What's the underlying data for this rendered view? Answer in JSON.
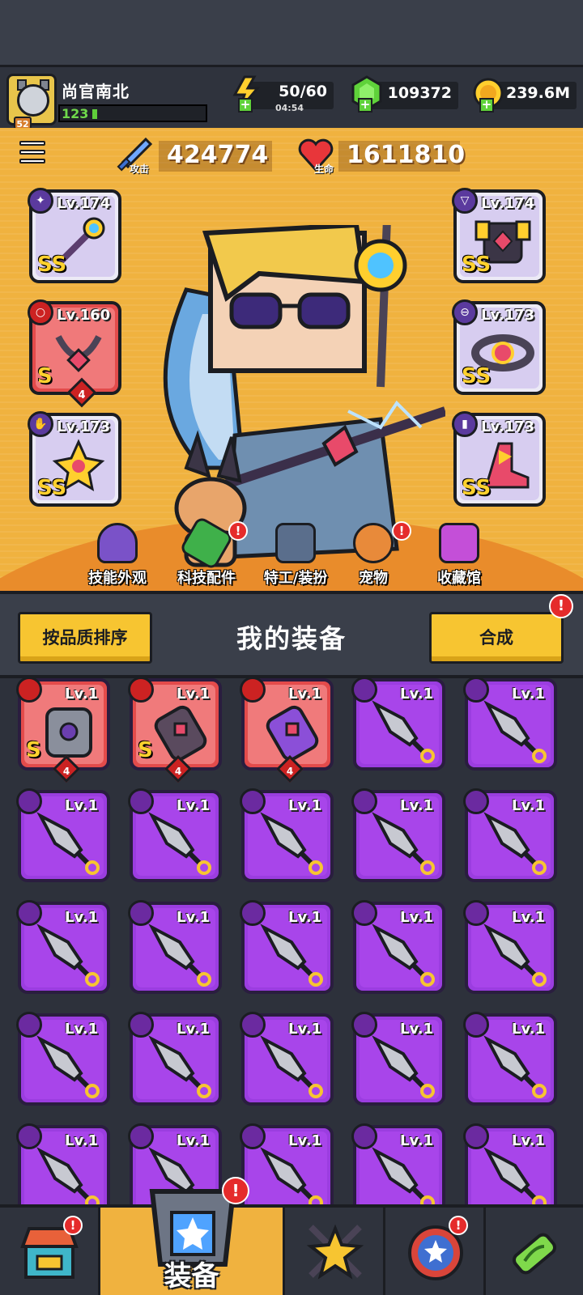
{
  "player": {
    "name": "尚官南北",
    "level_badge": "52",
    "xp_level": "123"
  },
  "resources": {
    "energy": {
      "value": "50/60",
      "timer": "04:54",
      "icon": "lightning-icon"
    },
    "gems": {
      "value": "109372",
      "icon": "green-gem-icon"
    },
    "coins": {
      "value": "239.6M",
      "icon": "gold-coin-icon"
    }
  },
  "stats": {
    "attack": {
      "value": "424774",
      "label": "攻击"
    },
    "health": {
      "value": "1611810",
      "label": "生命"
    }
  },
  "equipped": [
    {
      "slot": "weapon",
      "level": "Lv.174",
      "rank": "SS",
      "icon": "staff-weapon-icon"
    },
    {
      "slot": "necklace",
      "level": "Lv.160",
      "rank": "S",
      "stars": "4",
      "icon": "chain-necklace-icon"
    },
    {
      "slot": "gloves",
      "level": "Lv.173",
      "rank": "SS",
      "icon": "gauntlet-icon"
    },
    {
      "slot": "armor",
      "level": "Lv.174",
      "rank": "SS",
      "icon": "chest-armor-icon"
    },
    {
      "slot": "belt",
      "level": "Lv.173",
      "rank": "SS",
      "icon": "belt-icon"
    },
    {
      "slot": "boots",
      "level": "Lv.173",
      "rank": "SS",
      "icon": "boots-icon"
    }
  ],
  "features": [
    {
      "label": "技能外观",
      "icon": "skill-skin-icon",
      "alert": false
    },
    {
      "label": "科技配件",
      "icon": "tech-part-icon",
      "alert": true
    },
    {
      "label": "特工/装扮",
      "icon": "agent-costume-icon",
      "alert": false
    },
    {
      "label": "宠物",
      "icon": "pet-dog-icon",
      "alert": true
    },
    {
      "label": "收藏馆",
      "icon": "collection-chest-icon",
      "alert": false
    }
  ],
  "equipment_panel": {
    "sort_button": "按品质排序",
    "title": "我的装备",
    "merge_button": "合成"
  },
  "inventory": [
    {
      "level": "Lv.1",
      "rarity": "red",
      "rank": "S",
      "stars": "4",
      "icon": "armor-icon"
    },
    {
      "level": "Lv.1",
      "rarity": "red",
      "rank": "S",
      "stars": "4",
      "icon": "glove-icon"
    },
    {
      "level": "Lv.1",
      "rarity": "red",
      "rank": "",
      "stars": "4",
      "icon": "glove-icon"
    },
    {
      "level": "Lv.1",
      "rarity": "purple",
      "icon": "kunai-icon"
    },
    {
      "level": "Lv.1",
      "rarity": "purple",
      "icon": "kunai-icon"
    },
    {
      "level": "Lv.1",
      "rarity": "purple",
      "icon": "kunai-icon"
    },
    {
      "level": "Lv.1",
      "rarity": "purple",
      "icon": "kunai-icon"
    },
    {
      "level": "Lv.1",
      "rarity": "purple",
      "icon": "kunai-icon"
    },
    {
      "level": "Lv.1",
      "rarity": "purple",
      "icon": "kunai-icon"
    },
    {
      "level": "Lv.1",
      "rarity": "purple",
      "icon": "kunai-icon"
    },
    {
      "level": "Lv.1",
      "rarity": "purple",
      "icon": "kunai-icon"
    },
    {
      "level": "Lv.1",
      "rarity": "purple",
      "icon": "kunai-icon"
    },
    {
      "level": "Lv.1",
      "rarity": "purple",
      "icon": "kunai-icon"
    },
    {
      "level": "Lv.1",
      "rarity": "purple",
      "icon": "kunai-icon"
    },
    {
      "level": "Lv.1",
      "rarity": "purple",
      "icon": "kunai-icon"
    },
    {
      "level": "Lv.1",
      "rarity": "purple",
      "icon": "kunai-icon"
    },
    {
      "level": "Lv.1",
      "rarity": "purple",
      "icon": "kunai-icon"
    },
    {
      "level": "Lv.1",
      "rarity": "purple",
      "icon": "kunai-icon"
    },
    {
      "level": "Lv.1",
      "rarity": "purple",
      "icon": "kunai-icon"
    },
    {
      "level": "Lv.1",
      "rarity": "purple",
      "icon": "kunai-icon"
    },
    {
      "level": "Lv.1",
      "rarity": "purple",
      "icon": "kunai-icon"
    },
    {
      "level": "Lv.1",
      "rarity": "purple",
      "icon": "kunai-icon"
    },
    {
      "level": "Lv.1",
      "rarity": "purple",
      "icon": "kunai-icon"
    },
    {
      "level": "Lv.1",
      "rarity": "purple",
      "icon": "kunai-icon"
    },
    {
      "level": "Lv.1",
      "rarity": "purple",
      "icon": "kunai-icon"
    }
  ],
  "bottom_nav": [
    {
      "id": "shop",
      "label": "",
      "icon": "shop-icon",
      "alert": true
    },
    {
      "id": "equipment",
      "label": "装备",
      "icon": "equipment-icon",
      "alert": true,
      "active": true
    },
    {
      "id": "battle",
      "label": "",
      "icon": "battle-star-icon",
      "alert": false
    },
    {
      "id": "events",
      "label": "",
      "icon": "planet-icon",
      "alert": true
    },
    {
      "id": "lab",
      "label": "",
      "icon": "dna-capsule-icon",
      "alert": false
    }
  ],
  "alert_mark": "!",
  "colors": {
    "hero_bg": "#f0b23f",
    "purple_rarity": "#9b3de0",
    "red_rarity": "#e34b4b",
    "button_yellow": "#f7c531"
  }
}
